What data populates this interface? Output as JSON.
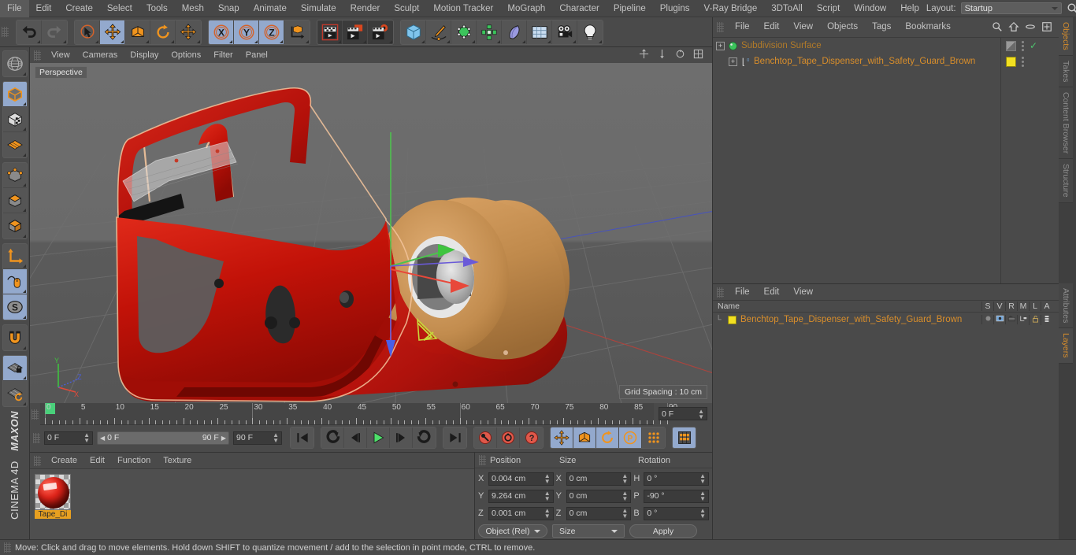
{
  "app": {
    "brand_maxon": "MAXON",
    "brand_product": "CINEMA 4D"
  },
  "menubar": {
    "items": [
      "File",
      "Edit",
      "Create",
      "Select",
      "Tools",
      "Mesh",
      "Snap",
      "Animate",
      "Simulate",
      "Render",
      "Sculpt",
      "Motion Tracker",
      "MoGraph",
      "Character",
      "Pipeline",
      "Plugins",
      "V-Ray Bridge",
      "3DToAll",
      "Script",
      "Window",
      "Help"
    ],
    "layout_label": "Layout:",
    "layout_value": "Startup",
    "search_icon": "search-icon",
    "home_icon": "home-icon",
    "ellipse_icon": "ellipse-icon",
    "layout_grid_icon": "layout-grid-icon"
  },
  "toolbar": {
    "groups": [
      {
        "name": "history",
        "buttons": [
          {
            "icon": "undo-icon",
            "state": "off"
          },
          {
            "icon": "redo-icon",
            "state": "disabled"
          }
        ]
      },
      {
        "name": "transform",
        "buttons": [
          {
            "icon": "live-selection-icon",
            "state": "off"
          },
          {
            "icon": "move-icon",
            "state": "on"
          },
          {
            "icon": "scale-icon",
            "state": "off"
          },
          {
            "icon": "rotate-icon",
            "state": "off"
          },
          {
            "icon": "move-axis-icon",
            "state": "off"
          }
        ]
      },
      {
        "name": "axis-lock",
        "buttons": [
          {
            "icon": "x-axis-icon",
            "state": "on"
          },
          {
            "icon": "y-axis-icon",
            "state": "on"
          },
          {
            "icon": "z-axis-icon",
            "state": "on"
          },
          {
            "icon": "world-object-coord-icon",
            "state": "off"
          }
        ]
      },
      {
        "name": "render",
        "buttons": [
          {
            "icon": "render-view-icon",
            "state": "dark"
          },
          {
            "icon": "render-region-icon",
            "state": "dark"
          },
          {
            "icon": "render-settings-icon",
            "state": "dark"
          }
        ]
      },
      {
        "name": "create",
        "buttons": [
          {
            "icon": "cube-primitive-icon",
            "state": "off"
          },
          {
            "icon": "spline-pen-icon",
            "state": "off"
          },
          {
            "icon": "generator-icon",
            "state": "off"
          },
          {
            "icon": "mograph-array-icon",
            "state": "off"
          },
          {
            "icon": "deformer-icon",
            "state": "off"
          },
          {
            "icon": "scene-floor-icon",
            "state": "off"
          },
          {
            "icon": "camera-icon",
            "state": "off"
          },
          {
            "icon": "light-icon",
            "state": "off"
          }
        ]
      }
    ]
  },
  "left_palette": {
    "groups": [
      {
        "buttons": [
          {
            "icon": "make-editable-icon",
            "state": "off"
          }
        ]
      },
      {
        "buttons": [
          {
            "icon": "model-mode-icon",
            "state": "on"
          },
          {
            "icon": "texture-mode-icon",
            "state": "off"
          },
          {
            "icon": "workplane-mode-icon",
            "state": "off"
          }
        ]
      },
      {
        "buttons": [
          {
            "icon": "point-mode-icon",
            "state": "off"
          },
          {
            "icon": "edge-mode-icon",
            "state": "off"
          },
          {
            "icon": "polygon-mode-icon",
            "state": "off"
          }
        ]
      },
      {
        "buttons": [
          {
            "icon": "object-axis-icon",
            "state": "off"
          },
          {
            "icon": "viewport-solo-icon",
            "state": "on"
          },
          {
            "icon": "enable-snapping-icon",
            "state": "on"
          }
        ]
      },
      {
        "buttons": [
          {
            "icon": "magnet-icon",
            "state": "off"
          }
        ]
      },
      {
        "buttons": [
          {
            "icon": "lock-workplane-icon",
            "state": "on"
          },
          {
            "icon": "planar-workplane-icon",
            "state": "off"
          }
        ]
      }
    ]
  },
  "viewport": {
    "menu": [
      "View",
      "Cameras",
      "Display",
      "Options",
      "Filter",
      "Panel"
    ],
    "label": "Perspective",
    "grid_spacing": "Grid Spacing : 10 cm",
    "axis_gizmo": {
      "x": "X",
      "y": "Y",
      "z": "Z",
      "x_color": "#e04a3a",
      "y_color": "#4ac24a",
      "z_color": "#4a5fe0"
    },
    "scene": {
      "object_color": "#c01810",
      "tape_roll_color": "#c8914e",
      "selection_outline": "#f2c49a",
      "bg_top": "#6d6d6d",
      "bg_bottom": "#545454"
    }
  },
  "timeline": {
    "ticks": [
      0,
      5,
      10,
      15,
      20,
      25,
      30,
      35,
      40,
      45,
      50,
      55,
      60,
      65,
      70,
      75,
      80,
      85,
      90
    ],
    "current_frame_marker": "0",
    "current_frame_field": "0 F",
    "start_field": "0 F",
    "range_start": "0 F",
    "range_end": "90 F",
    "end_field": "90 F",
    "buttons": [
      {
        "icon": "go-to-start-icon",
        "state": "off"
      },
      {
        "icon": "previous-key-icon",
        "state": "off"
      },
      {
        "icon": "step-back-icon",
        "state": "off"
      },
      {
        "icon": "play-icon",
        "state": "off"
      },
      {
        "icon": "step-forward-icon",
        "state": "off"
      },
      {
        "icon": "next-key-icon",
        "state": "off"
      },
      {
        "icon": "go-to-end-icon",
        "state": "off"
      },
      {
        "icon": "record-key-icon",
        "state": "off"
      },
      {
        "icon": "autokeying-icon",
        "state": "off"
      },
      {
        "icon": "keyframe-selection-icon",
        "state": "off"
      },
      {
        "icon": "key-position-icon",
        "state": "on"
      },
      {
        "icon": "key-scale-icon",
        "state": "on"
      },
      {
        "icon": "key-rotation-icon",
        "state": "on"
      },
      {
        "icon": "key-param-icon",
        "state": "on"
      },
      {
        "icon": "key-pla-icon",
        "state": "off"
      },
      {
        "icon": "timeline-window-icon",
        "state": "on"
      }
    ]
  },
  "material_manager": {
    "menu": [
      "Create",
      "Edit",
      "Function",
      "Texture"
    ],
    "materials": [
      {
        "name": "Tape_Di",
        "color": "#c01810"
      }
    ]
  },
  "coordinates": {
    "columns": [
      "Position",
      "Size",
      "Rotation"
    ],
    "rows": [
      {
        "pos_axis": "X",
        "pos_value": "0.004 cm",
        "size_axis": "X",
        "size_value": "0 cm",
        "rot_axis": "H",
        "rot_value": "0 °"
      },
      {
        "pos_axis": "Y",
        "pos_value": "9.264 cm",
        "size_axis": "Y",
        "size_value": "0 cm",
        "rot_axis": "P",
        "rot_value": "-90 °"
      },
      {
        "pos_axis": "Z",
        "pos_value": "0.001 cm",
        "size_axis": "Z",
        "size_value": "0 cm",
        "rot_axis": "B",
        "rot_value": "0 °"
      }
    ],
    "mode_dropdown": "Object (Rel)",
    "size_dropdown": "Size",
    "apply_button": "Apply"
  },
  "object_manager": {
    "menu": [
      "File",
      "Edit",
      "View",
      "Objects",
      "Tags",
      "Bookmarks"
    ],
    "rows": [
      {
        "name": "Subdivision Surface",
        "icon": "subdivision-surface-icon",
        "indent": 0,
        "enabled_check": "✓",
        "tag_swatch": "none"
      },
      {
        "name": "Benchtop_Tape_Dispenser_with_Safety_Guard_Brown",
        "icon": "polygon-object-icon",
        "indent": 1,
        "enabled_check": "",
        "tag_swatch": "#f2e021"
      }
    ]
  },
  "layers_manager": {
    "menu": [
      "File",
      "Edit",
      "View"
    ],
    "columns": [
      "Name",
      "S",
      "V",
      "R",
      "M",
      "L",
      "A"
    ],
    "rows": [
      {
        "name": "Benchtop_Tape_Dispenser_with_Safety_Guard_Brown",
        "color": "#f2e021"
      }
    ]
  },
  "right_tabs_top": [
    "Objects",
    "Takes",
    "Content Browser",
    "Structure"
  ],
  "right_tabs_bottom": [
    "Attributes",
    "Layers"
  ],
  "statusbar": {
    "text": "Move: Click and drag to move elements. Hold down SHIFT to quantize movement / add to the selection in point mode, CTRL to remove."
  }
}
